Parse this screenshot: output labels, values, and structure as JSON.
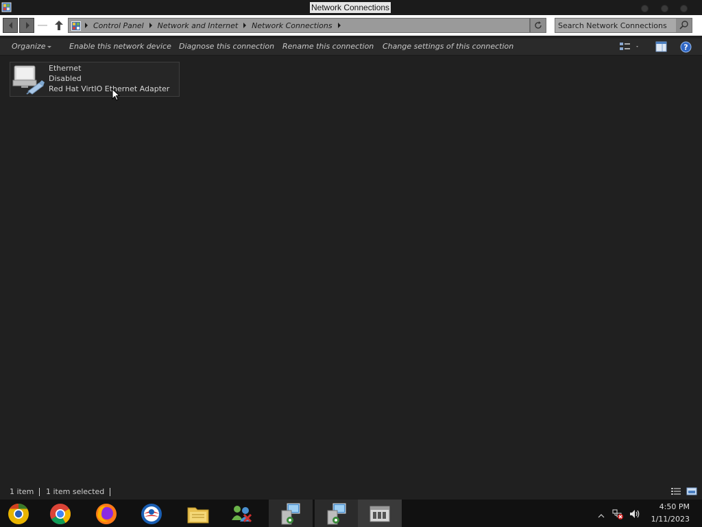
{
  "window": {
    "title": "Network Connections"
  },
  "address": {
    "crumbs": [
      "Control Panel",
      "Network and Internet",
      "Network Connections"
    ]
  },
  "search": {
    "placeholder": "Search Network Connections"
  },
  "toolbar": {
    "organize": "Organize",
    "enable": "Enable this network device",
    "diagnose": "Diagnose this connection",
    "rename": "Rename this connection",
    "change_settings": "Change settings of this connection"
  },
  "items": [
    {
      "name": "Ethernet",
      "status": "Disabled",
      "adapter": "Red Hat VirtIO Ethernet Adapter"
    }
  ],
  "statusbar": {
    "count": "1 item",
    "selected": "1 item selected"
  },
  "taskbar": {
    "apps": [
      "chrome-canary",
      "chrome",
      "firefox",
      "opera",
      "file-explorer",
      "network-people",
      "remote-desktop-1",
      "remote-desktop-2",
      "network-connections-window"
    ],
    "clock_time": "4:50 PM",
    "clock_date": "1/11/2023"
  },
  "colors": {
    "background": "#202020",
    "toolbar": "#2a2a2a",
    "address_bar": "#9a9a9a",
    "taskbar": "#111111"
  }
}
